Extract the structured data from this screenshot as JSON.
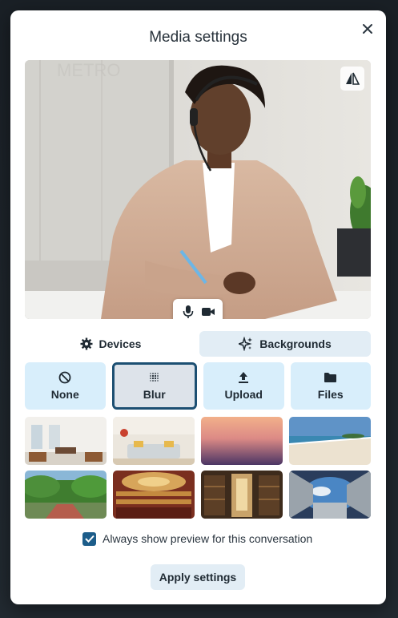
{
  "dialog": {
    "title": "Media settings"
  },
  "preview": {
    "icons": {
      "close": "close-icon",
      "mirror": "mirror-flip-icon",
      "mic": "microphone-icon",
      "camera": "camera-icon"
    }
  },
  "tabs": [
    {
      "label": "Devices",
      "icon": "gear-icon",
      "active": false
    },
    {
      "label": "Backgrounds",
      "icon": "sparkle-icon",
      "active": true
    }
  ],
  "background_options": [
    {
      "label": "None",
      "icon": "none-icon",
      "selected": false
    },
    {
      "label": "Blur",
      "icon": "blur-icon",
      "selected": true
    },
    {
      "label": "Upload",
      "icon": "upload-icon",
      "selected": false
    },
    {
      "label": "Files",
      "icon": "folder-icon",
      "selected": false
    }
  ],
  "thumbnails": [
    "office-room",
    "living-room",
    "sunset-gradient",
    "beach",
    "tropical-bridge",
    "theater",
    "library",
    "space-station"
  ],
  "preference": {
    "label": "Always show preview for this conversation",
    "checked": true
  },
  "apply_label": "Apply settings",
  "colors": {
    "accent": "#1c4f72",
    "option_bg": "#d8eefb",
    "tab_active_bg": "#e2edf5",
    "checkbox": "#1c5d8a"
  }
}
